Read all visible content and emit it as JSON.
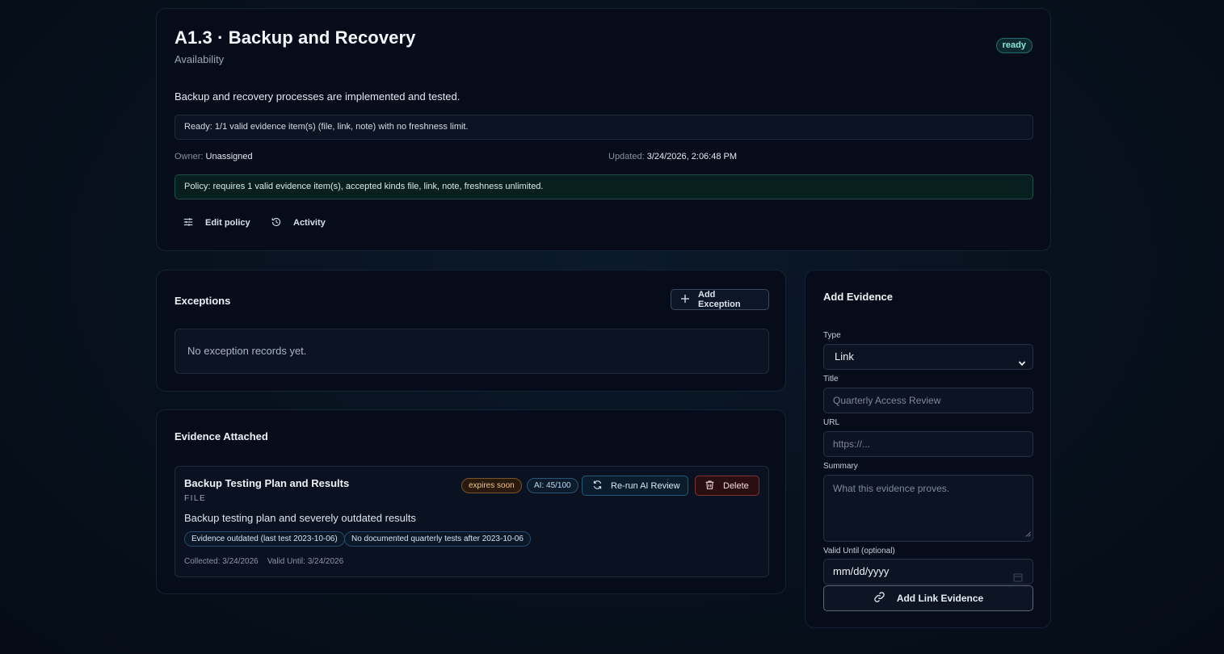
{
  "control": {
    "title": "A1.3 · Backup and Recovery",
    "category": "Availability",
    "status_badge": "ready",
    "description": "Backup and recovery processes are implemented and tested.",
    "readiness_text": "Ready: 1/1 valid evidence item(s) (file, link, note) with no freshness limit.",
    "owner_label": "Owner:",
    "owner_value": "Unassigned",
    "updated_label": "Updated:",
    "updated_value": "3/24/2026, 2:06:48 PM",
    "policy_text": "Policy: requires 1 valid evidence item(s), accepted kinds file, link, note, freshness unlimited.",
    "edit_policy_label": "Edit policy",
    "activity_label": "Activity"
  },
  "exceptions": {
    "heading": "Exceptions",
    "add_button_label": "Add Exception",
    "empty_text": "No exception records yet."
  },
  "evidence": {
    "heading": "Evidence Attached",
    "items": [
      {
        "title": "Backup Testing Plan and Results",
        "kind": "FILE",
        "freshness_badge": "expires soon",
        "ai_badge": "AI: 45/100",
        "rerun_label": "Re-run AI Review",
        "delete_label": "Delete",
        "summary": "Backup testing plan and severely outdated results",
        "flags": [
          "Evidence outdated (last test 2023-10-06)",
          "No documented quarterly tests after 2023-10-06"
        ],
        "collected": "Collected: 3/24/2026",
        "valid_until": "Valid Until: 3/24/2026"
      }
    ]
  },
  "add_evidence": {
    "heading": "Add Evidence",
    "type_label": "Type",
    "type_value": "Link",
    "title_label": "Title",
    "title_placeholder": "Quarterly Access Review",
    "url_label": "URL",
    "url_placeholder": "https://...",
    "summary_label": "Summary",
    "summary_placeholder": "What this evidence proves.",
    "valid_until_label": "Valid Until (optional)",
    "valid_until_value": "mm/dd/yyyy",
    "submit_label": "Add Link Evidence"
  },
  "colors": {
    "background": "#07111d",
    "card": "#060c19",
    "ready_accent": "#8fe3d9",
    "warning": "#f0c48a",
    "danger": "#7b3434"
  }
}
